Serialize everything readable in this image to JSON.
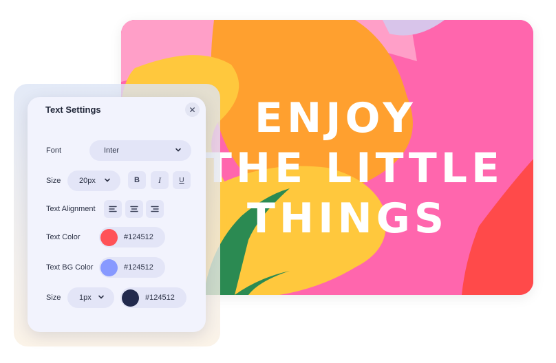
{
  "panel": {
    "title": "Text Settings",
    "close_icon": "close-icon",
    "font": {
      "label": "Font",
      "value": "Inter"
    },
    "size": {
      "label": "Size",
      "value": "20px",
      "bold": "B",
      "italic": "I",
      "underline": "U"
    },
    "alignment": {
      "label": "Text Alignment"
    },
    "text_color": {
      "label": "Text Color",
      "hex": "#124512",
      "swatch": "#ff5257"
    },
    "bg_color": {
      "label": "Text BG Color",
      "hex": "#124512",
      "swatch": "#8799ff"
    },
    "stroke": {
      "label": "Size",
      "value": "1px",
      "hex": "#124512",
      "swatch": "#222a4d"
    }
  },
  "canvas": {
    "lines": [
      "ENJOY",
      "THE LITTLE",
      "THINGS"
    ]
  }
}
